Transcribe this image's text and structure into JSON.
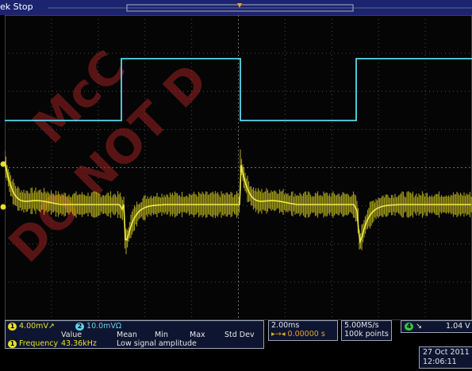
{
  "topbar": {
    "state": "ek Stop"
  },
  "channels": {
    "ch1": {
      "num": "1",
      "scale": "4.00mV↗",
      "color": "#e8e02c"
    },
    "ch2": {
      "num": "2",
      "scale": "10.0mVΩ",
      "color": "#5dd6ee"
    }
  },
  "measure": {
    "headers": [
      "Value",
      "Mean",
      "Min",
      "Max",
      "Std Dev"
    ],
    "source": "1",
    "name": "Frequency",
    "value": "43.36kHz",
    "note": "Low signal amplitude"
  },
  "timebase": {
    "scale": "2.00ms",
    "delay": "▸→◂ 0.00000 s"
  },
  "acquisition": {
    "rate": "5.00MS/s",
    "points": "100k points"
  },
  "trigger": {
    "source": "4",
    "slope": "↘",
    "level": "1.04 V"
  },
  "datetime": {
    "date": "27 Oct 2011",
    "time": "12:06:11"
  },
  "watermark": {
    "line1": "McC",
    "line2": "DO NOT D"
  }
}
